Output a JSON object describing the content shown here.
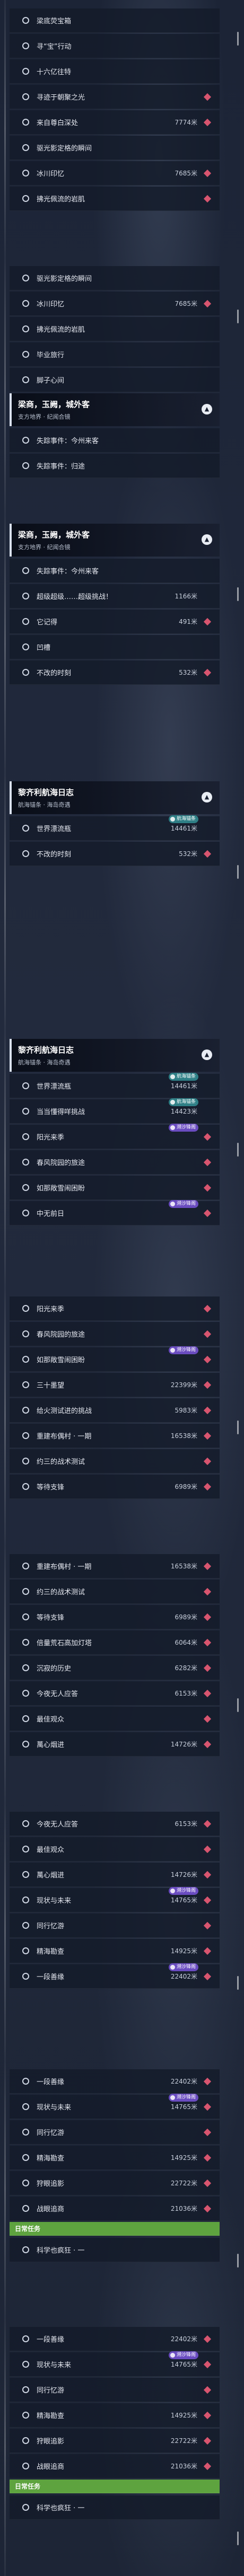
{
  "common": {
    "header_icon": "chevron-up-icon",
    "quest_dot_icon": "circle-outline-icon",
    "tracked_icon": "diamond-marker-icon"
  },
  "colors": {
    "tracked_marker": "#d8556f",
    "tag_purple": "#6a4cc0",
    "tag_teal": "#2f7f86",
    "daily_bar": "#5ea33f"
  },
  "screens": [
    {
      "rows": [
        {
          "type": "quest",
          "label": "梁底荧宝箱",
          "dist": "",
          "marker": false
        },
        {
          "type": "quest",
          "label": "寻“宝”行动",
          "dist": "",
          "marker": false
        },
        {
          "type": "quest",
          "label": "十六亿往特",
          "dist": "",
          "marker": false
        },
        {
          "type": "quest",
          "label": "寻迹于朝聚之光",
          "dist": "",
          "marker": true
        },
        {
          "type": "quest",
          "label": "来自尊白深处",
          "dist": "7774米",
          "marker": true
        },
        {
          "type": "quest",
          "label": "驱光影定格的瞬间",
          "dist": "",
          "marker": false
        },
        {
          "type": "quest",
          "label": "冰川印忆",
          "dist": "7685米",
          "marker": true
        },
        {
          "type": "quest",
          "label": "拂光佩流的岩肌",
          "dist": "",
          "marker": true
        }
      ]
    },
    {
      "rows": [
        {
          "type": "quest",
          "label": "驱光影定格的瞬间",
          "dist": "",
          "marker": false
        },
        {
          "type": "quest",
          "label": "冰川印忆",
          "dist": "7685米",
          "marker": true
        },
        {
          "type": "quest",
          "label": "拂光佩流的岩肌",
          "dist": "",
          "marker": false
        },
        {
          "type": "quest",
          "label": "毕业旅行",
          "dist": "",
          "marker": false
        },
        {
          "type": "quest",
          "label": "脚子心间",
          "dist": "",
          "marker": false
        }
      ],
      "header": {
        "title": "梁商，玉阙，城外客",
        "subtitle": "支方地界 · 纪闻合镜"
      },
      "rows_after": [
        {
          "type": "quest",
          "label": "失踪事件：今州来客",
          "dist": "",
          "marker": false
        },
        {
          "type": "quest",
          "label": "失踪事件：归途",
          "dist": "",
          "marker": false
        }
      ]
    },
    {
      "header": {
        "title": "梁商，玉阙，城外客",
        "subtitle": "支方地界 · 纪闻合镜"
      },
      "rows_after": [
        {
          "type": "quest",
          "label": "失踪事件：今州来客",
          "dist": "",
          "marker": false
        },
        {
          "type": "quest",
          "label": "超级超级……超级挑战！",
          "dist": "1166米",
          "marker": false
        },
        {
          "type": "quest",
          "label": "它记得",
          "dist": "491米",
          "marker": true
        },
        {
          "type": "quest",
          "label": "凹槽",
          "dist": "",
          "marker": false
        },
        {
          "type": "quest",
          "label": "不改的时刻",
          "dist": "532米",
          "marker": true
        }
      ]
    },
    {
      "header": {
        "title": "黎齐利航海日志",
        "subtitle": "航海锚条 · 海岛奇遇"
      },
      "rows_after": [
        {
          "type": "quest",
          "label": "世界漂流瓶",
          "dist": "14461米",
          "marker": false,
          "tag": {
            "text": "航海锚条",
            "style": "teal"
          }
        },
        {
          "type": "quest",
          "label": "不改的时刻",
          "dist": "532米",
          "marker": true
        }
      ]
    },
    {
      "header": {
        "title": "黎齐利航海日志",
        "subtitle": "航海锚条 · 海岛奇遇"
      },
      "rows_after": [
        {
          "type": "quest",
          "label": "世界漂流瓶",
          "dist": "14461米",
          "marker": false,
          "tag": {
            "text": "航海锚条",
            "style": "teal"
          }
        },
        {
          "type": "quest",
          "label": "当当懂得咩挑战",
          "dist": "14423米",
          "marker": false,
          "tag": {
            "text": "航海锚条",
            "style": "teal"
          }
        },
        {
          "type": "quest",
          "label": "阳光来季",
          "dist": "",
          "marker": true,
          "tag": {
            "text": "溯沙锋阁",
            "style": "purple"
          }
        },
        {
          "type": "quest",
          "label": "春风院园的旅途",
          "dist": "",
          "marker": true
        },
        {
          "type": "quest",
          "label": "如那敞雪闹困盼",
          "dist": "",
          "marker": true
        },
        {
          "type": "quest",
          "label": "中无前日",
          "dist": "",
          "marker": true,
          "tag": {
            "text": "溯沙锋阁",
            "style": "purple"
          }
        }
      ]
    },
    {
      "rows": [
        {
          "type": "quest",
          "label": "阳光来季",
          "dist": "",
          "marker": true
        },
        {
          "type": "quest",
          "label": "春风院园的旅途",
          "dist": "",
          "marker": true
        },
        {
          "type": "quest",
          "label": "如那敞雪闹困盼",
          "dist": "",
          "marker": true,
          "tag": {
            "text": "溯沙锋阁",
            "style": "purple"
          }
        },
        {
          "type": "quest",
          "label": "三十墨望",
          "dist": "22399米",
          "marker": true
        },
        {
          "type": "quest",
          "label": "给火测试进的挑战",
          "dist": "5983米",
          "marker": true
        },
        {
          "type": "quest",
          "label": "重建布偶村 · 一期",
          "dist": "16538米",
          "marker": true
        },
        {
          "type": "quest",
          "label": "约三的战术测试",
          "dist": "",
          "marker": true
        },
        {
          "type": "quest",
          "label": "等待支锋",
          "dist": "6989米",
          "marker": true
        }
      ]
    },
    {
      "rows": [
        {
          "type": "quest",
          "label": "重建布偶村 · 一期",
          "dist": "16538米",
          "marker": true
        },
        {
          "type": "quest",
          "label": "约三的战术测试",
          "dist": "",
          "marker": true
        },
        {
          "type": "quest",
          "label": "等待支锋",
          "dist": "6989米",
          "marker": true
        },
        {
          "type": "quest",
          "label": "倍量荒石高加灯塔",
          "dist": "6064米",
          "marker": true
        },
        {
          "type": "quest",
          "label": "沉寂的历史",
          "dist": "6282米",
          "marker": true
        },
        {
          "type": "quest",
          "label": "今夜无人应答",
          "dist": "6153米",
          "marker": true
        },
        {
          "type": "quest",
          "label": "最佳观众",
          "dist": "",
          "marker": true
        },
        {
          "type": "quest",
          "label": "萬心烟进",
          "dist": "14726米",
          "marker": true
        }
      ]
    },
    {
      "rows": [
        {
          "type": "quest",
          "label": "今夜无人应答",
          "dist": "6153米",
          "marker": true
        },
        {
          "type": "quest",
          "label": "最佳观众",
          "dist": "",
          "marker": true
        },
        {
          "type": "quest",
          "label": "萬心烟进",
          "dist": "14726米",
          "marker": true
        },
        {
          "type": "quest",
          "label": "现状与未来",
          "dist": "14765米",
          "marker": true,
          "tag": {
            "text": "溯沙锋阁",
            "style": "purple"
          }
        },
        {
          "type": "quest",
          "label": "同行忆游",
          "dist": "",
          "marker": true
        },
        {
          "type": "quest",
          "label": "精海勘查",
          "dist": "14925米",
          "marker": true
        },
        {
          "type": "quest",
          "label": "一段善缘",
          "dist": "22402米",
          "marker": true,
          "tag": {
            "text": "溯沙锋阁",
            "style": "purple"
          }
        }
      ]
    },
    {
      "rows": [
        {
          "type": "quest",
          "label": "一段善缘",
          "dist": "22402米",
          "marker": true
        },
        {
          "type": "quest",
          "label": "现状与未来",
          "dist": "14765米",
          "marker": true,
          "tag": {
            "text": "溯沙锋阁",
            "style": "purple"
          }
        },
        {
          "type": "quest",
          "label": "同行忆游",
          "dist": "",
          "marker": true
        },
        {
          "type": "quest",
          "label": "精海勘查",
          "dist": "14925米",
          "marker": true
        },
        {
          "type": "quest",
          "label": "狩眼追影",
          "dist": "22722米",
          "marker": true
        },
        {
          "type": "quest",
          "label": "战眼追商",
          "dist": "21036米",
          "marker": true
        },
        {
          "type": "category",
          "label": "日常任务",
          "dist": "",
          "marker": false
        },
        {
          "type": "quest",
          "label": "科学也疯狂 · 一",
          "dist": "",
          "marker": false
        }
      ]
    },
    {
      "rows": [
        {
          "type": "quest",
          "label": "一段善缘",
          "dist": "22402米",
          "marker": true
        },
        {
          "type": "quest",
          "label": "现状与未来",
          "dist": "14765米",
          "marker": true,
          "tag": {
            "text": "溯沙锋阁",
            "style": "purple"
          }
        },
        {
          "type": "quest",
          "label": "同行忆游",
          "dist": "",
          "marker": true
        },
        {
          "type": "quest",
          "label": "精海勘查",
          "dist": "14925米",
          "marker": true
        },
        {
          "type": "quest",
          "label": "狩眼追影",
          "dist": "22722米",
          "marker": true
        },
        {
          "type": "quest",
          "label": "战眼追商",
          "dist": "21036米",
          "marker": true
        },
        {
          "type": "category",
          "label": "日常任务",
          "dist": "",
          "marker": false
        },
        {
          "type": "quest",
          "label": "科学也疯狂 · 一",
          "dist": "",
          "marker": false
        }
      ]
    }
  ]
}
